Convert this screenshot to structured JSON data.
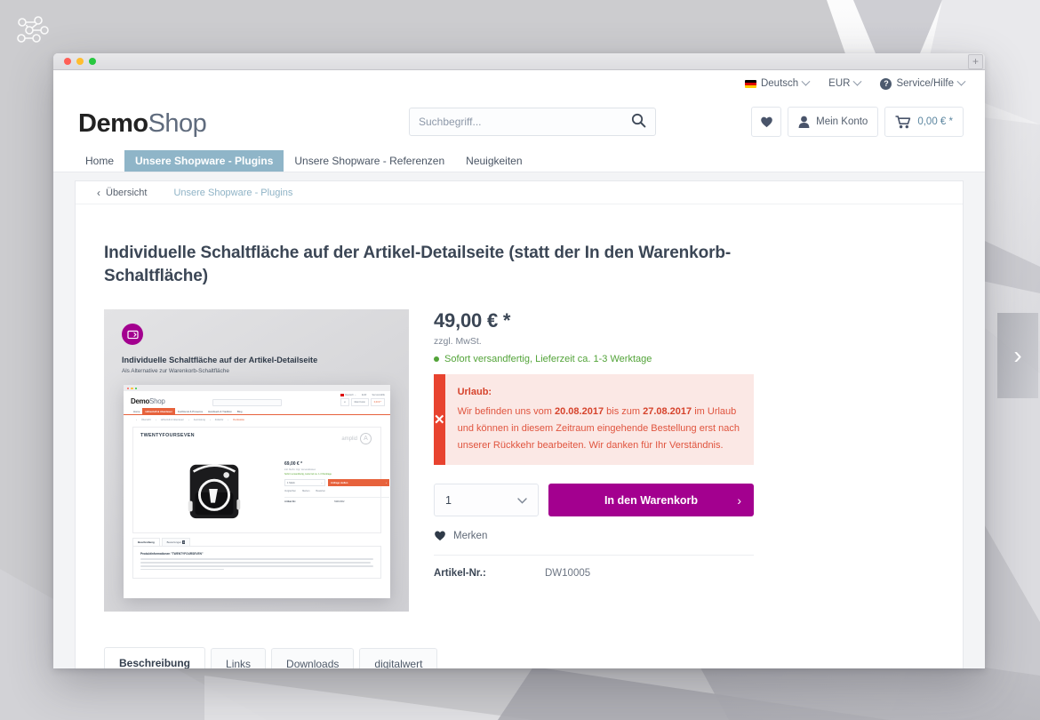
{
  "app": {
    "logo_name": "graph-nodes-logo"
  },
  "window": {
    "traffic_lights": [
      "close",
      "minimize",
      "maximize"
    ],
    "new_tab_label": "+"
  },
  "topbar": {
    "language": "Deutsch",
    "currency": "EUR",
    "service": "Service/Hilfe"
  },
  "header": {
    "logo_bold": "Demo",
    "logo_light": "Shop",
    "search_placeholder": "Suchbegriff...",
    "search_value": "",
    "wishlist_label": "",
    "account_label": "Mein Konto",
    "cart_label": "0,00 € *"
  },
  "nav": {
    "items": [
      {
        "label": "Home",
        "active": false
      },
      {
        "label": "Unsere Shopware - Plugins",
        "active": true
      },
      {
        "label": "Unsere Shopware - Referenzen",
        "active": false
      },
      {
        "label": "Neuigkeiten",
        "active": false
      }
    ]
  },
  "breadcrumb": {
    "back_label": "Übersicht",
    "current": "Unsere Shopware - Plugins"
  },
  "product": {
    "title": "Individuelle Schaltfläche auf der Artikel-Detailseite (statt der In den Warenkorb-Schaltfläche)",
    "price": "49,00 € *",
    "tax_note": "zzgl. MwSt.",
    "stock": "Sofort versandfertig, Lieferzeit ca. 1-3 Werktage",
    "quantity": "1",
    "buy_label": "In den Warenkorb",
    "buy_arrow": "›",
    "remember_label": "Merken",
    "article_label": "Artikel-Nr.:",
    "article_value": "DW10005"
  },
  "alert": {
    "close_glyph": "✕",
    "title": "Urlaub:",
    "text_1": "Wir befinden uns vom ",
    "date_from": "20.08.2017",
    "text_2": " bis zum ",
    "date_to": "27.08.2017",
    "text_3": " im Urlaub und können in diesem Zeitraum eingehende Bestellung erst nach unserer Rückkehr bearbeiten. Wir danken für Ihr Verständnis."
  },
  "product_image": {
    "badge_icon": "screen-arrow-icon",
    "headline": "Individuelle Schaltfläche auf der Artikel-Detailseite",
    "subline": "Als Alternative zur Warenkorb-Schaltfläche",
    "inner": {
      "logo_bold": "Demo",
      "logo_light": "Shop",
      "search_placeholder": "Suchbegriff...",
      "account_label": "Mein Konto",
      "cart_label": "0,00 € *",
      "lang": "Deutsch",
      "currency": "EUR",
      "service": "Service/Hilfe",
      "nav": [
        "Home",
        "Höhenluft & Abenteuer",
        "Kochkunst & Provence",
        "Handwerk & Tradition",
        "Blog"
      ],
      "nav_active_index": 1,
      "breadcrumb": [
        "Übersicht",
        "Höhenluft & Abenteuer",
        "Ausrüstung",
        "Zubehör",
        "Rucksäcke"
      ],
      "product_name": "TWENTYFOURSEVEN",
      "brand": "amplid",
      "price": "69,00 € *",
      "tax_note": "inkl. MwSt. zzgl. Versandkosten",
      "stock": "Sofort versandfertig, Lieferzeit ca. 1-3 Werktage",
      "qty": "1 Stück",
      "cta": "Anfrage stellen",
      "links": [
        "Vergleichen",
        "Merken",
        "Bewerten"
      ],
      "article_label": "Artikel-Nr.:",
      "article_value": "SW10002",
      "tabs": [
        "Beschreibung",
        "Bewertungen"
      ],
      "tab_badge": "0",
      "desc_title": "Produktinformationen \"TWENTYFOURSEVEN\""
    }
  },
  "tabs": {
    "items": [
      {
        "label": "Beschreibung",
        "active": true
      },
      {
        "label": "Links",
        "active": false
      },
      {
        "label": "Downloads",
        "active": false
      },
      {
        "label": "digitalwert",
        "active": false
      }
    ]
  },
  "carousel": {
    "next_glyph": "›"
  },
  "colors": {
    "accent_purple": "#a3008f",
    "nav_active": "#8fb5c8",
    "alert_red": "#e8432f",
    "alert_bg": "#fbe8e5",
    "stock_green": "#52a338",
    "inner_orange": "#e7623c"
  }
}
